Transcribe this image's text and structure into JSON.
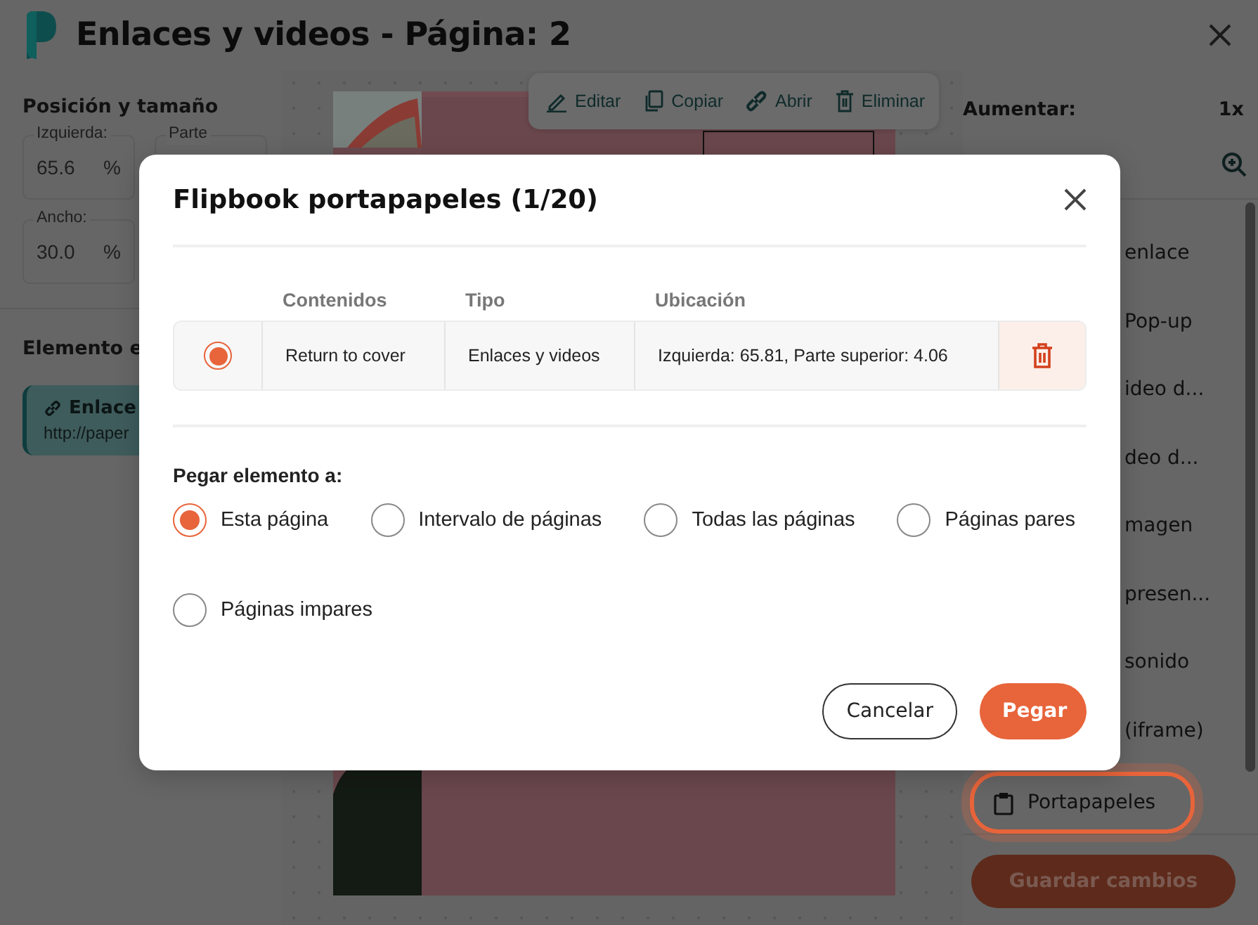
{
  "window": {
    "title": "Enlaces y videos - Página: 2"
  },
  "left_panel": {
    "heading": "Posición y tamaño",
    "fields": [
      {
        "label": "Izquierda:",
        "value": "65.6",
        "unit": "%"
      },
      {
        "label": "Parte"
      },
      {
        "label": "Ancho:",
        "value": "30.0",
        "unit": "%"
      }
    ],
    "elements_heading": "Elemento e",
    "element_card": {
      "title": "Enlace",
      "url": "http://paper"
    }
  },
  "canvas": {
    "page": {
      "kind": "picture"
    },
    "toolbar": [
      "Editar",
      "Copiar",
      "Abrir",
      "Eliminar"
    ]
  },
  "right_panel": {
    "zoom_label": "Aumentar:",
    "zoom_value": "1x",
    "items": [
      {
        "label": "enlace",
        "highlighted": false
      },
      {
        "label": "Pop-up",
        "highlighted": false
      },
      {
        "label": "ideo d...",
        "highlighted": false
      },
      {
        "label": "deo d...",
        "highlighted": false
      },
      {
        "label": "magen",
        "highlighted": false
      },
      {
        "label": "presen...",
        "highlighted": false
      },
      {
        "label": "sonido",
        "highlighted": false
      },
      {
        "label": "(iframe)",
        "highlighted": false
      },
      {
        "label": "Portapapeles",
        "highlighted": true
      }
    ],
    "save_button": "Guardar cambios"
  },
  "dialog": {
    "title": "Flipbook portapapeles (1/20)",
    "columns": [
      "Contenidos",
      "Tipo",
      "Ubicación"
    ],
    "rows": [
      {
        "selected": true,
        "contents": "Return to cover",
        "type": "Enlaces y videos",
        "location": "Izquierda: 65.81, Parte superior: 4.06"
      }
    ],
    "paste_label": "Pegar elemento a:",
    "paste_options": [
      {
        "label": "Esta página",
        "selected": true
      },
      {
        "label": "Intervalo de páginas",
        "selected": false
      },
      {
        "label": "Todas las páginas",
        "selected": false
      },
      {
        "label": "Páginas pares",
        "selected": false
      },
      {
        "label": "Páginas impares",
        "selected": false
      }
    ],
    "buttons": [
      {
        "label": "Cancelar",
        "kind": "secondary"
      },
      {
        "label": "Pegar",
        "kind": "primary"
      }
    ]
  }
}
